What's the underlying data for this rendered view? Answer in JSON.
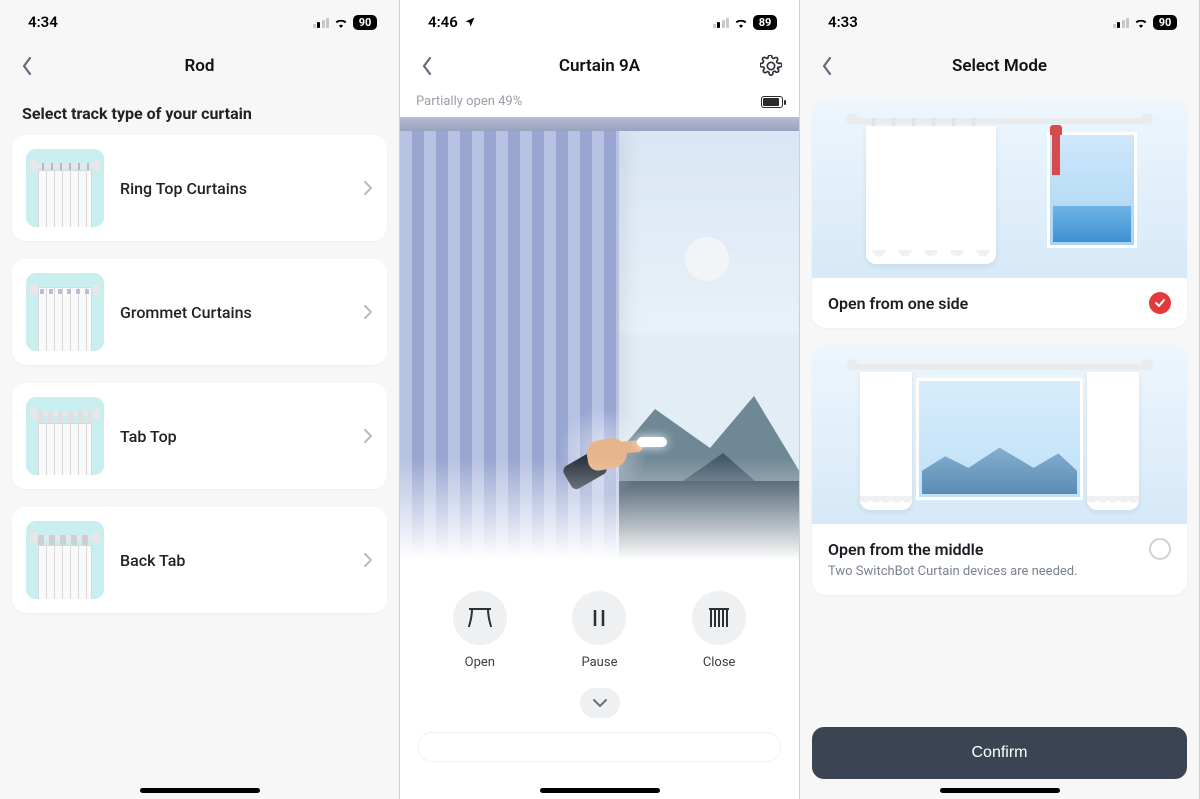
{
  "screen1": {
    "status": {
      "time": "4:34",
      "battery": "90"
    },
    "title": "Rod",
    "section_title": "Select track type of your curtain",
    "items": [
      {
        "label": "Ring Top Curtains"
      },
      {
        "label": "Grommet Curtains"
      },
      {
        "label": "Tab Top"
      },
      {
        "label": "Back Tab"
      }
    ]
  },
  "screen2": {
    "status": {
      "time": "4:46",
      "battery": "89"
    },
    "title": "Curtain 9A",
    "substatus": "Partially open 49%",
    "controls": {
      "open": "Open",
      "pause": "Pause",
      "close": "Close"
    }
  },
  "screen3": {
    "status": {
      "time": "4:33",
      "battery": "90"
    },
    "title": "Select Mode",
    "option1": {
      "title": "Open from one side"
    },
    "option2": {
      "title": "Open from the middle",
      "subtitle": "Two SwitchBot Curtain devices are needed."
    },
    "confirm": "Confirm"
  }
}
